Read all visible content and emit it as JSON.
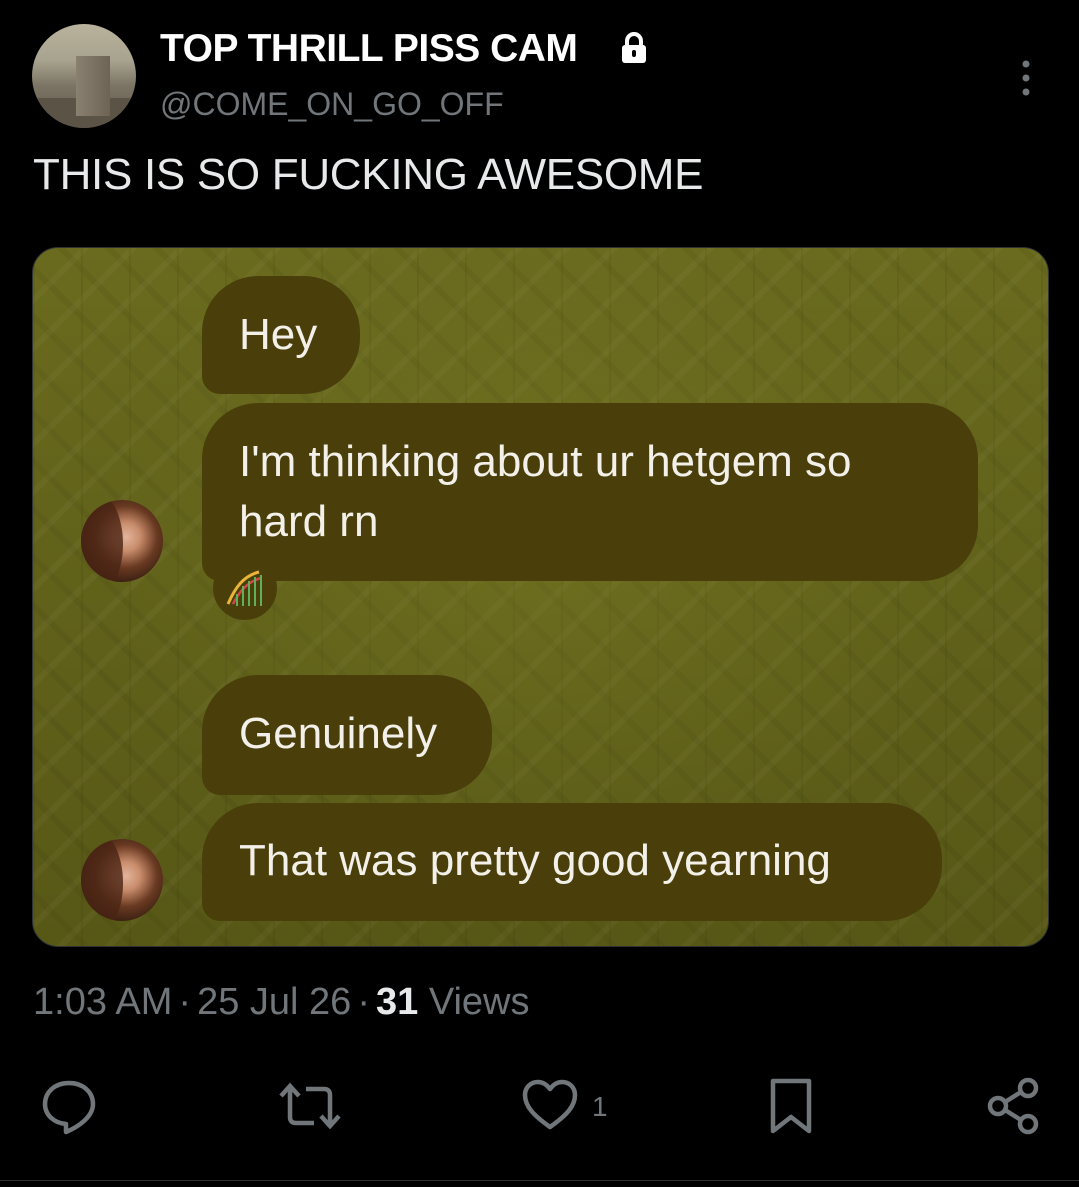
{
  "author": {
    "display_name": "TOP THRILL PISS CAM",
    "handle": "@COME_ON_GO_OFF",
    "protected_icon": "lock-icon"
  },
  "tweet": {
    "text": "THIS IS SO FUCKING AWESOME"
  },
  "media": {
    "messages": [
      {
        "text": "Hey"
      },
      {
        "lines": [
          "I'm thinking about ur hetgem so",
          "hard rn"
        ]
      },
      {
        "text": "Genuinely"
      },
      {
        "text": "That was pretty good yearning"
      }
    ],
    "reaction_icon": "roller-coaster-icon",
    "colors": {
      "background": "#5e5f18",
      "bubble": "#4a3f0b"
    }
  },
  "meta": {
    "time": "1:03 AM",
    "date": "25 Jul 26",
    "views_count": "31",
    "views_label": "Views",
    "separator": "·"
  },
  "actions": {
    "reply_icon": "reply-icon",
    "repost_icon": "repost-icon",
    "like_icon": "heart-icon",
    "like_count": "1",
    "bookmark_icon": "bookmark-icon",
    "share_icon": "share-icon",
    "more_icon": "more-vertical-icon"
  }
}
